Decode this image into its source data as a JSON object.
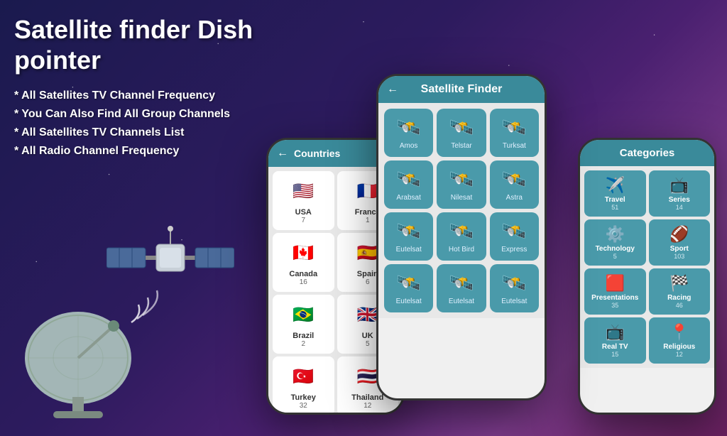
{
  "app": {
    "title": "Satellite finder Dish pointer",
    "features": [
      "* All Satellites TV Channel Frequency",
      "* You Can Also Find All Group Channels",
      "* All Satellites TV Channels List",
      "* All Radio Channel Frequency"
    ]
  },
  "countries_phone": {
    "header": "Countries",
    "countries": [
      {
        "name": "USA",
        "count": "7",
        "flag": "🇺🇸"
      },
      {
        "name": "France",
        "count": "1",
        "flag": "🇫🇷"
      },
      {
        "name": "Canada",
        "count": "16",
        "flag": "🇨🇦"
      },
      {
        "name": "Spain",
        "count": "6",
        "flag": "🇪🇸"
      },
      {
        "name": "Brazil",
        "count": "2",
        "flag": "🇧🇷"
      },
      {
        "name": "UK",
        "count": "5",
        "flag": "🇬🇧"
      },
      {
        "name": "Turkey",
        "count": "32",
        "flag": "🇹🇷"
      },
      {
        "name": "Thailand",
        "count": "12",
        "flag": "🇹🇭"
      }
    ]
  },
  "satellite_phone": {
    "header": "Satellite Finder",
    "satellites": [
      {
        "name": "Amos"
      },
      {
        "name": "Telstar"
      },
      {
        "name": "Turksat"
      },
      {
        "name": "Arabsat"
      },
      {
        "name": "Nilesat"
      },
      {
        "name": "Astra"
      },
      {
        "name": "Eutelsat"
      },
      {
        "name": "Hot Bird"
      },
      {
        "name": "Express"
      },
      {
        "name": "Eutelsat"
      },
      {
        "name": "Eutelsat"
      },
      {
        "name": "Eutelsat"
      }
    ]
  },
  "categories_phone": {
    "header": "Categories",
    "categories": [
      {
        "name": "Travel",
        "count": "51",
        "icon": "✈️"
      },
      {
        "name": "Series",
        "count": "14",
        "icon": "📺"
      },
      {
        "name": "Technology",
        "count": "5",
        "icon": "⚙️"
      },
      {
        "name": "Sport",
        "count": "103",
        "icon": "🏈"
      },
      {
        "name": "Presentations",
        "count": "35",
        "icon": "🟥"
      },
      {
        "name": "Racing",
        "count": "46",
        "icon": "🏁"
      },
      {
        "name": "Real TV",
        "count": "15",
        "icon": "📺"
      },
      {
        "name": "Religious",
        "count": "12",
        "icon": "📍"
      }
    ]
  },
  "colors": {
    "teal": "#3a8a9a",
    "tile_bg": "#4a9aaa",
    "bg_dark": "#1a1a4e"
  }
}
